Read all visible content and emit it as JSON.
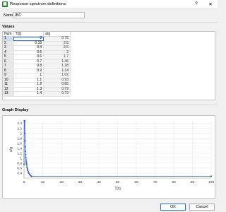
{
  "window": {
    "title": "Response spectrum definitions",
    "app_icon": "green-app-icon",
    "help_label": "?",
    "close_label": "✕"
  },
  "name_field": {
    "label": "Name",
    "value": "IBC"
  },
  "values_section": {
    "title": "Values",
    "columns": [
      "Num",
      "T[s]",
      "a/g"
    ],
    "rows": [
      {
        "num": "1",
        "t": "0",
        "a": "0.75"
      },
      {
        "num": "2",
        "t": "0.15",
        "a": "2.5"
      },
      {
        "num": "3",
        "t": "0.4",
        "a": "2.5"
      },
      {
        "num": "4",
        "t": "0.5",
        "a": "2"
      },
      {
        "num": "5",
        "t": "0.6",
        "a": "1.7"
      },
      {
        "num": "6",
        "t": "0.7",
        "a": "1.46"
      },
      {
        "num": "7",
        "t": "0.8",
        "a": "1.28"
      },
      {
        "num": "8",
        "t": "0.9",
        "a": "1.14"
      },
      {
        "num": "9",
        "t": "1",
        "a": "1.02"
      },
      {
        "num": "10",
        "t": "1.1",
        "a": "0.93"
      },
      {
        "num": "11",
        "t": "1.2",
        "a": "0.85"
      },
      {
        "num": "12",
        "t": "1.3",
        "a": "0.79"
      },
      {
        "num": "13",
        "t": "1.4",
        "a": "0.73"
      }
    ],
    "selected_row": 1
  },
  "graph_section": {
    "title": "Graph Display"
  },
  "chart_data": {
    "type": "line",
    "xlabel": "T[s]",
    "ylabel": "a/g",
    "xlim": [
      0,
      100
    ],
    "ylim": [
      0.2,
      2.5
    ],
    "xticks": [
      "0",
      "10",
      "20",
      "30",
      "40",
      "50",
      "60",
      "70",
      "80",
      "90",
      "100"
    ],
    "yticks": [
      "0.4",
      "0.6",
      "0.8",
      "1",
      "1.2",
      "1.4",
      "1.6",
      "1.8",
      "2",
      "2.2",
      "2.4"
    ],
    "grid": true,
    "series": [
      {
        "color": "#3a5fcd",
        "x": [
          0,
          0.15,
          0.4,
          0.5,
          0.6,
          0.7,
          0.8,
          0.9,
          1,
          1.1,
          1.2,
          1.3,
          1.4,
          1.6,
          1.8,
          2,
          2.3,
          2.6,
          3,
          3.5,
          4,
          100
        ],
        "y": [
          0.75,
          2.5,
          2.5,
          2,
          1.7,
          1.46,
          1.28,
          1.14,
          1.02,
          0.93,
          0.85,
          0.79,
          0.73,
          0.64,
          0.57,
          0.51,
          0.45,
          0.4,
          0.35,
          0.3,
          0.27,
          0.27
        ]
      }
    ]
  },
  "buttons": {
    "ok": "OK",
    "cancel": "Cancel"
  }
}
